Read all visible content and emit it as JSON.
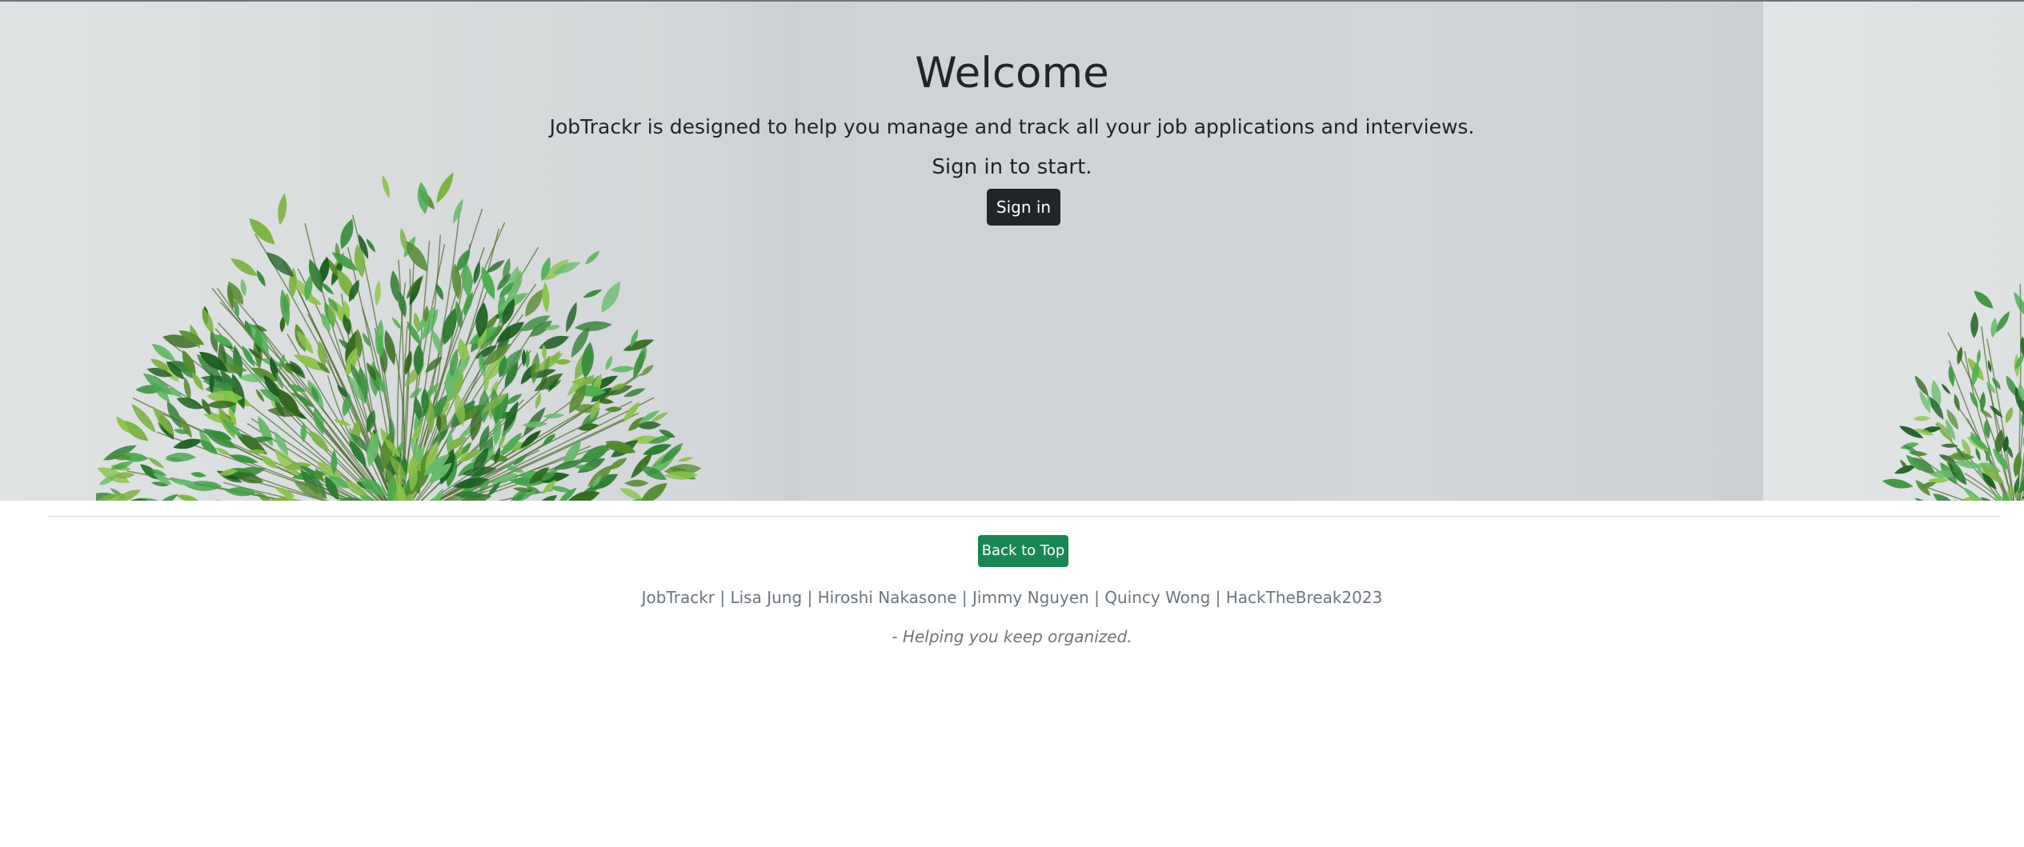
{
  "hero": {
    "title": "Welcome",
    "lead": "JobTrackr is designed to help you manage and track all your job applications and interviews.",
    "cta_text": "Sign in to start.",
    "signin_label": "Sign in",
    "background_image": "plant-background-image"
  },
  "footer": {
    "back_to_top_label": "Back to Top",
    "credits": "JobTrackr | Lisa Jung | Hiroshi Nakasone | Jimmy Nguyen | Quincy Wong | HackTheBreak2023",
    "tagline": "- Helping you keep organized."
  },
  "colors": {
    "text": "#212529",
    "signin_button": "#212529",
    "back_to_top_button": "#198754",
    "muted_text": "#6c757d",
    "foliage": "#3fa33a"
  }
}
